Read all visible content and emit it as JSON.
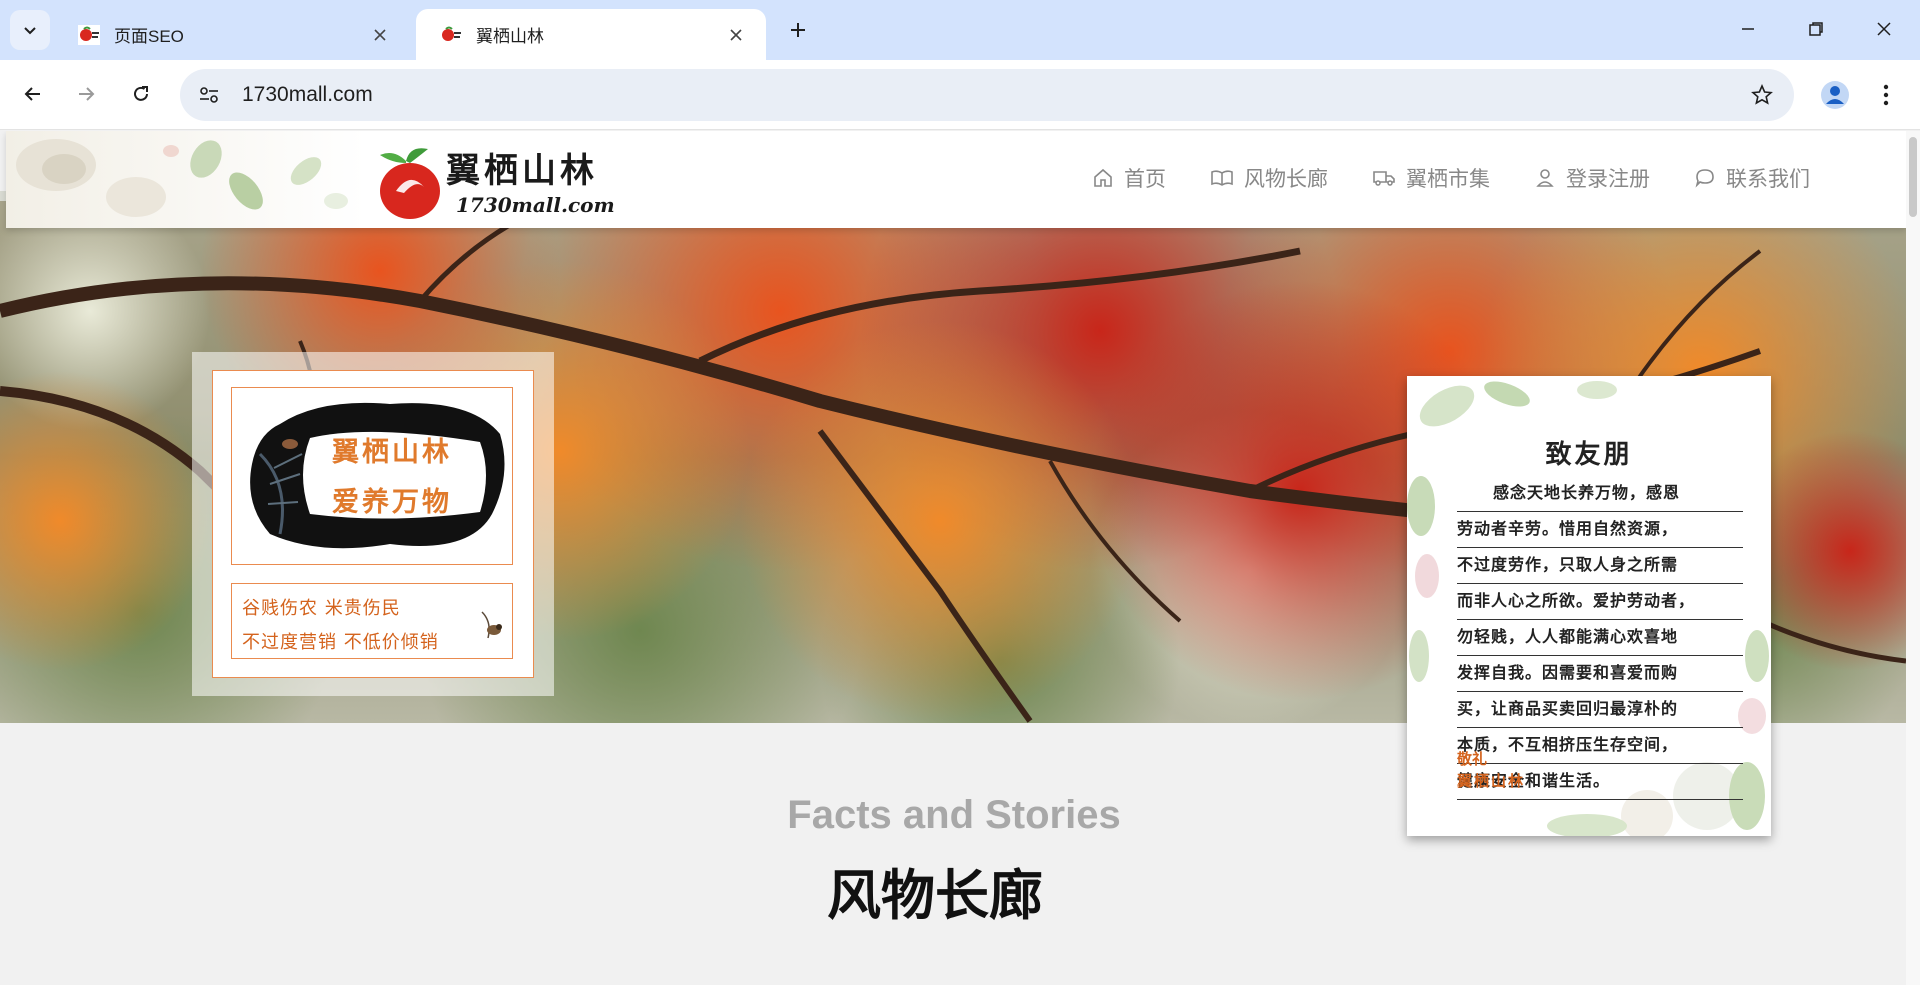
{
  "browser": {
    "tabs": [
      {
        "title": "页面SEO",
        "active": false
      },
      {
        "title": "翼栖山林",
        "active": true
      }
    ],
    "url": "1730mall.com"
  },
  "site": {
    "logo_name": "翼栖山林",
    "logo_url": "1730mall.com",
    "nav": [
      {
        "label": "首页",
        "icon": "home-icon"
      },
      {
        "label": "风物长廊",
        "icon": "book-open-icon"
      },
      {
        "label": "翼栖市集",
        "icon": "truck-icon"
      },
      {
        "label": "登录注册",
        "icon": "user-icon"
      },
      {
        "label": "联系我们",
        "icon": "chat-bubble-icon"
      }
    ]
  },
  "banner_left": {
    "slogan_line1": "翼栖山林",
    "slogan_line2": "爱养万物",
    "motto_line1": "谷贱伤农 米贵伤民",
    "motto_line2": "不过度营销 不低价倾销"
  },
  "letter": {
    "title": "致友朋",
    "lines": [
      "感念天地长养万物，感恩",
      "劳动者辛劳。惜用自然资源，",
      "不过度劳作，只取人身之所需",
      "而非人心之所欲。爱护劳动者，",
      "勿轻贱，人人都能满心欢喜地",
      "发挥自我。因需要和喜爱而购",
      "买，让商品买卖回归最淳朴的",
      "本质，不互相挤压生存空间，",
      "健康安全和谐生活。"
    ],
    "closing": "敬礼",
    "signature": "翼栖山林"
  },
  "section": {
    "english": "Facts and Stories",
    "chinese": "风物长廊"
  },
  "colors": {
    "tabbar": "#d3e3fd",
    "accent_orange": "#e07a2c",
    "nav_text": "#888888"
  }
}
